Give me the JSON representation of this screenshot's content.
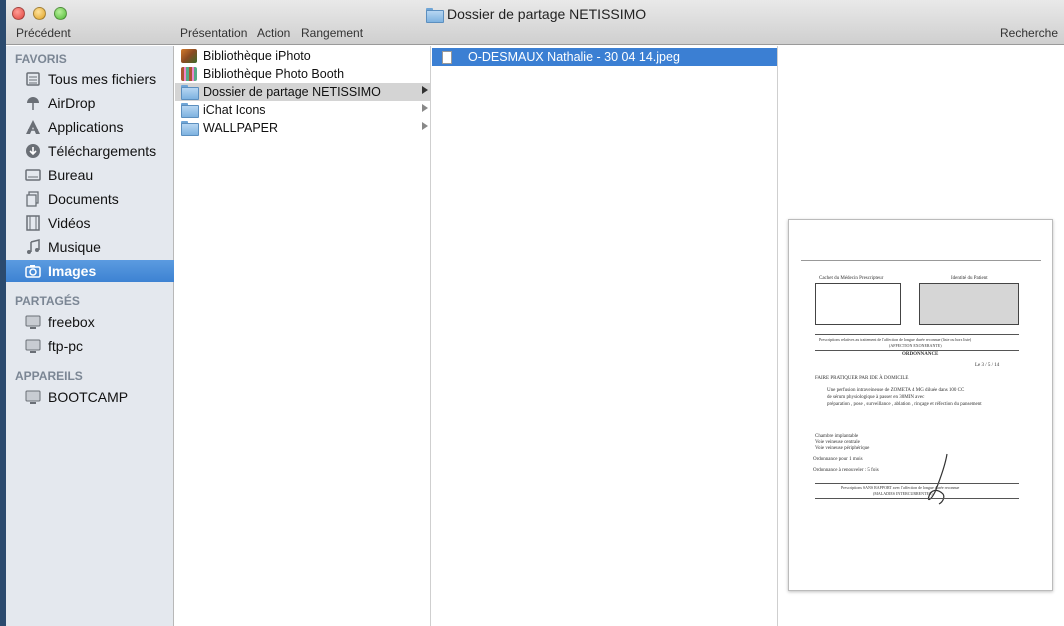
{
  "window": {
    "title": "Dossier de partage NETISSIMO"
  },
  "toolbar": {
    "back_label": "Précédent",
    "view_label": "Présentation",
    "action_label": "Action",
    "arrange_label": "Rangement",
    "search_label": "Recherche"
  },
  "sidebar": {
    "favorites_header": "FAVORIS",
    "favorites": [
      {
        "label": "Tous mes fichiers",
        "icon": "all-files-icon"
      },
      {
        "label": "AirDrop",
        "icon": "airdrop-icon"
      },
      {
        "label": "Applications",
        "icon": "applications-icon"
      },
      {
        "label": "Téléchargements",
        "icon": "downloads-icon"
      },
      {
        "label": "Bureau",
        "icon": "desktop-icon"
      },
      {
        "label": "Documents",
        "icon": "documents-icon"
      },
      {
        "label": "Vidéos",
        "icon": "movies-icon"
      },
      {
        "label": "Musique",
        "icon": "music-icon"
      },
      {
        "label": "Images",
        "icon": "camera-icon",
        "selected": true
      }
    ],
    "shared_header": "PARTAGÉS",
    "shared": [
      {
        "label": "freebox",
        "icon": "monitor-icon"
      },
      {
        "label": "ftp-pc",
        "icon": "monitor-icon"
      }
    ],
    "devices_header": "APPAREILS",
    "devices": [
      {
        "label": "BOOTCAMP",
        "icon": "drive-icon"
      }
    ]
  },
  "column1": {
    "items": [
      {
        "label": "Bibliothèque iPhoto",
        "icon": "iphoto-icon"
      },
      {
        "label": "Bibliothèque Photo Booth",
        "icon": "photo-booth-icon"
      },
      {
        "label": "Dossier de partage NETISSIMO",
        "icon": "folder-icon",
        "selected": true
      },
      {
        "label": "iChat Icons",
        "icon": "folder-alias-icon"
      },
      {
        "label": "WALLPAPER",
        "icon": "folder-icon"
      }
    ]
  },
  "column2": {
    "items": [
      {
        "label": "O-DESMAUX Nathalie - 30 04 14.jpeg",
        "icon": "jpeg-file-icon",
        "selected": true
      }
    ]
  },
  "preview": {
    "doc": {
      "prescriber_label": "Cachet du Médecin Prescripteur",
      "patient_label": "Identité du Patient",
      "line1": "Prescriptions relatives au traitement de l'affection de longue durée reconnue (liste ou hors liste)",
      "line1b": "(AFFECTION EXONERANTE)",
      "ordonnance": "ORDONNANCE",
      "date": "Le 3 / 5 / 14",
      "faire": "FAIRE PRATIQUER PAR IDE À DOMICILE",
      "p1": "Une perfusion intraveineuse de ZOMETA 4 MG diluée dans 100 CC",
      "p2": "de sérum physiologique à passer en 30MIN avec",
      "p3": "préparation , pose , surveillance , ablation , rinçage et réfection du pansement",
      "c1": "Chambre implantable",
      "c2": "Voie veineuse centrale",
      "c3": "Voie veineuse périphérique",
      "o1": "Ordonnance pour    1    mois",
      "o2": "Ordonnance à renouveler :  5  fois",
      "footer": "Prescriptions SANS RAPPORT avec l'affection de longue durée reconnue",
      "footer2": "(MALADIES INTERCURRENTES)"
    }
  }
}
